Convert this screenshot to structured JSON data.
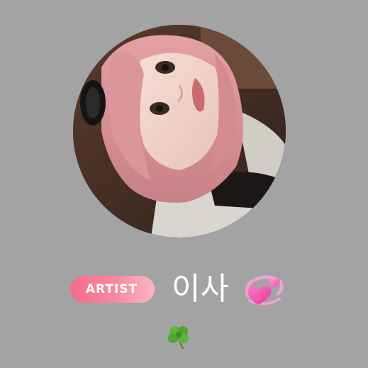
{
  "profile": {
    "badge_label": "ARTIST",
    "display_name": "이사",
    "name_emoji": "revolving-hearts-icon",
    "status_emoji": "four-leaf-clover-icon"
  },
  "colors": {
    "background": "#a3a3a3",
    "badge_start": "#f26d8a",
    "badge_end": "#fbb5c3",
    "name_text": "#ffffff"
  }
}
